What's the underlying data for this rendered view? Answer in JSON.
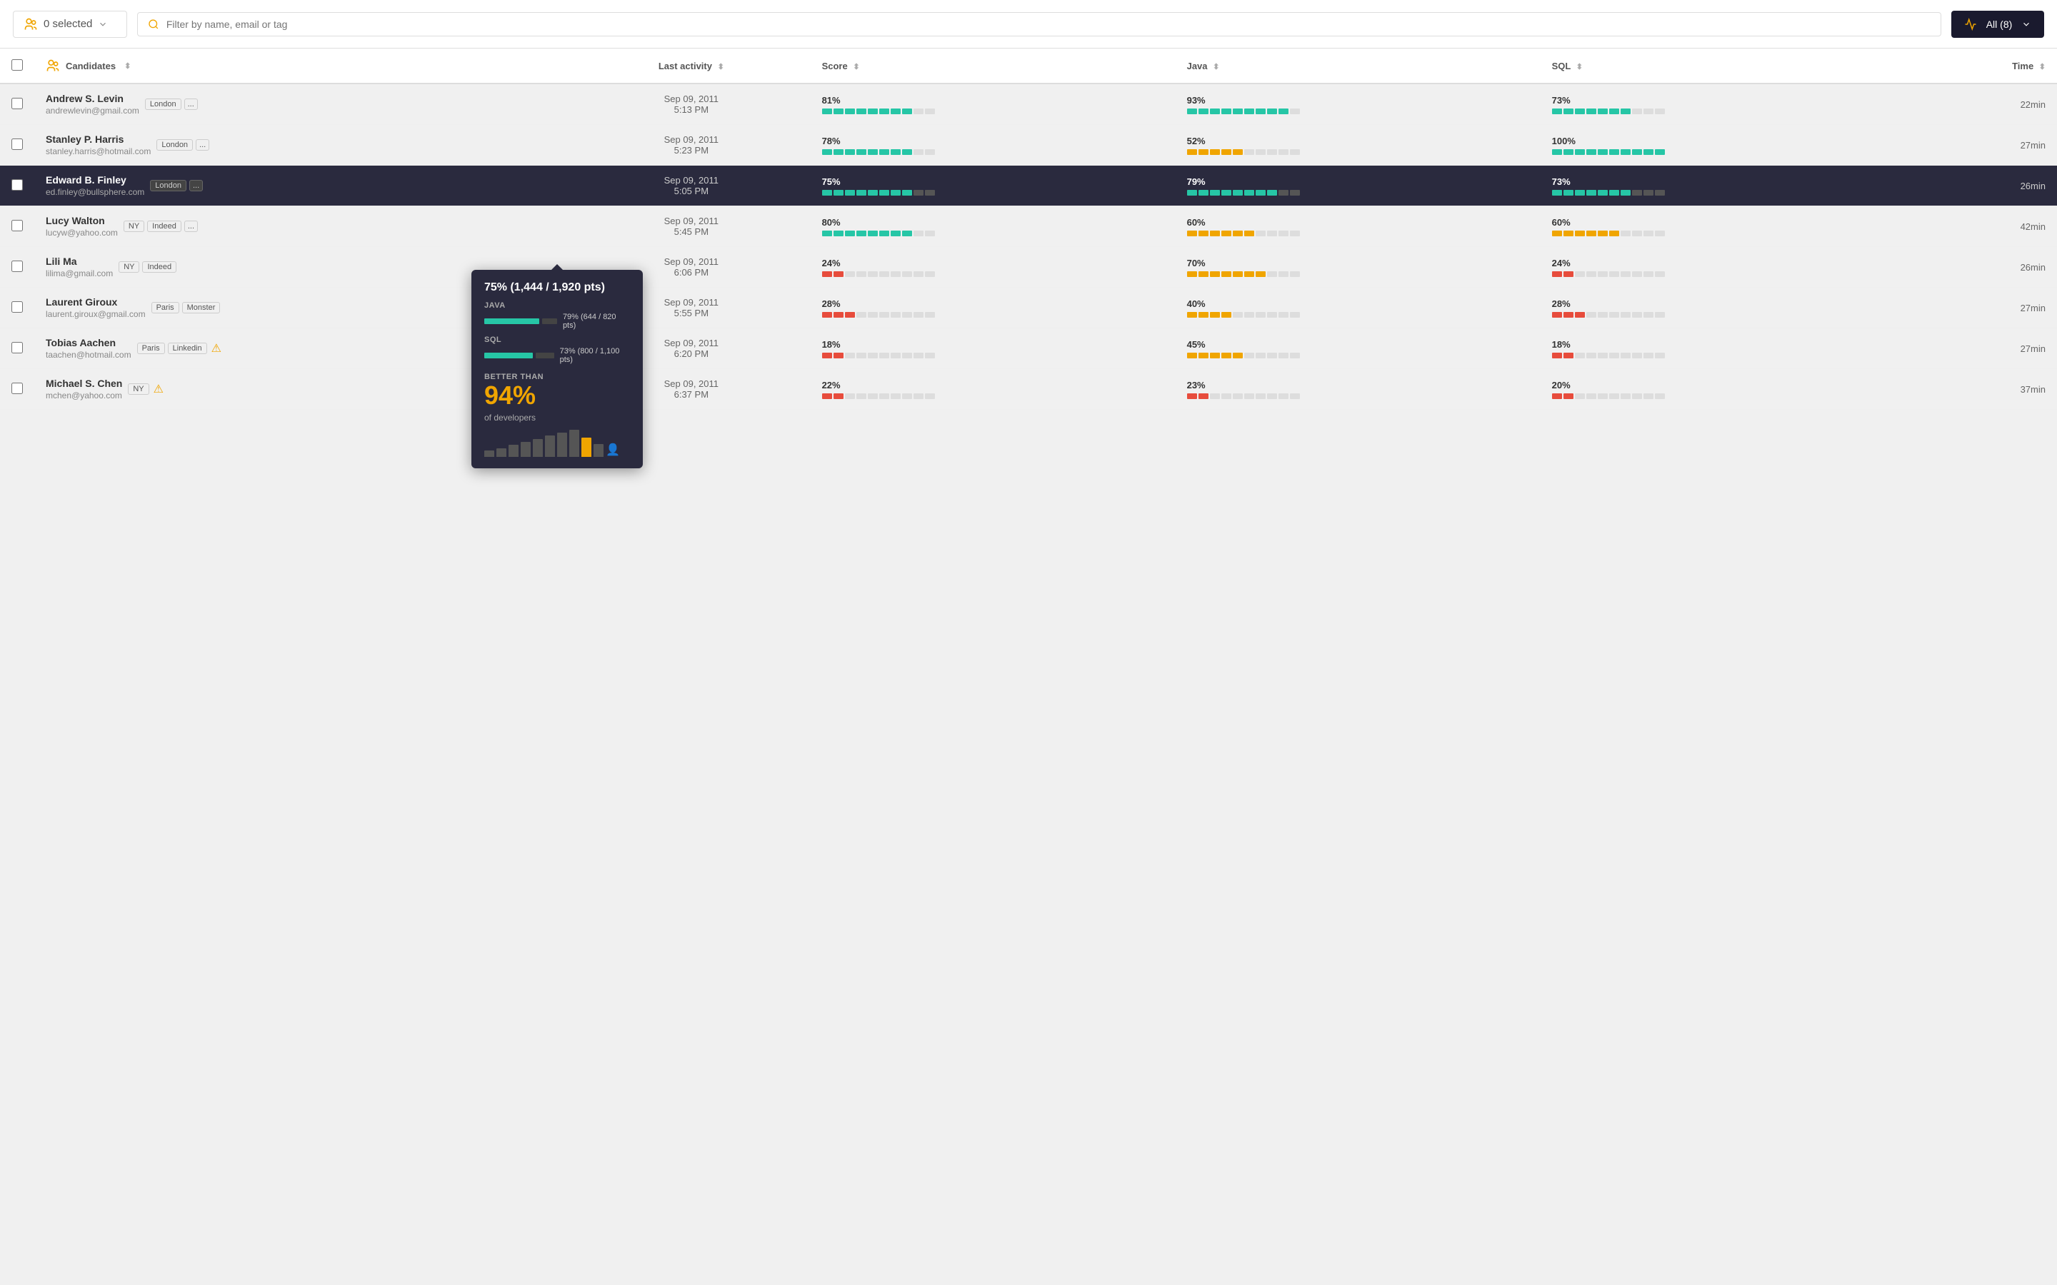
{
  "topbar": {
    "selected_label": "0 selected",
    "search_placeholder": "Filter by name, email or tag",
    "filter_label": "All (8)"
  },
  "table": {
    "columns": [
      "Candidates",
      "Last activity",
      "Score",
      "Java",
      "SQL",
      "Time"
    ],
    "rows": [
      {
        "id": 1,
        "name": "Andrew S. Levin",
        "email": "andrewlevin@gmail.com",
        "tags": [
          "London"
        ],
        "extra_tags": "...",
        "date": "Sep 09, 2011",
        "time_str": "5:13 PM",
        "score_pct": 81,
        "score_label": "81%",
        "score_color": "teal",
        "java_pct": 93,
        "java_label": "93%",
        "java_color": "teal",
        "sql_pct": 73,
        "sql_label": "73%",
        "sql_color": "teal",
        "duration": "22min",
        "highlighted": false,
        "warn": false
      },
      {
        "id": 2,
        "name": "Stanley P. Harris",
        "email": "stanley.harris@hotmail.com",
        "tags": [
          "London"
        ],
        "extra_tags": "...",
        "date": "Sep 09, 2011",
        "time_str": "5:23 PM",
        "score_pct": 78,
        "score_label": "78%",
        "score_color": "teal",
        "java_pct": 52,
        "java_label": "52%",
        "java_color": "yellow",
        "sql_pct": 100,
        "sql_label": "100%",
        "sql_color": "teal",
        "duration": "27min",
        "highlighted": false,
        "warn": false
      },
      {
        "id": 3,
        "name": "Edward B. Finley",
        "email": "ed.finley@bullsphere.com",
        "tags": [
          "London"
        ],
        "extra_tags": "...",
        "date": "Sep 09, 2011",
        "time_str": "5:05 PM",
        "score_pct": 75,
        "score_label": "75%",
        "score_color": "teal",
        "java_pct": 79,
        "java_label": "79%",
        "java_color": "teal",
        "sql_pct": 73,
        "sql_label": "73%",
        "sql_color": "teal",
        "duration": "26min",
        "highlighted": true,
        "warn": false,
        "tooltip": {
          "title": "75% (1,444 / 1,920 pts)",
          "java_label": "JAVA",
          "java_pct": "79% (644 / 820 pts)",
          "java_bar": 79,
          "sql_label": "SQL",
          "sql_pct": "73% (800 / 1,100 pts)",
          "sql_bar": 73,
          "better_than_label": "BETTER THAN",
          "better_than_pct": "94%",
          "of_devs": "of developers",
          "histogram_bars": [
            15,
            20,
            28,
            35,
            42,
            50,
            58,
            65,
            45,
            30
          ]
        }
      },
      {
        "id": 4,
        "name": "Lucy Walton",
        "email": "lucyw@yahoo.com",
        "tags": [
          "NY",
          "Indeed"
        ],
        "extra_tags": "...",
        "date": "Sep 09, 2011",
        "time_str": "5:45 PM",
        "score_pct": 80,
        "score_label": "80%",
        "score_color": "teal",
        "java_pct": 60,
        "java_label": "60%",
        "java_color": "yellow",
        "sql_pct": 60,
        "sql_label": "60%",
        "sql_color": "yellow",
        "duration": "42min",
        "highlighted": false,
        "warn": false
      },
      {
        "id": 5,
        "name": "Lili Ma",
        "email": "lilima@gmail.com",
        "tags": [
          "NY",
          "Indeed"
        ],
        "extra_tags": null,
        "date": "Sep 09, 2011",
        "time_str": "6:06 PM",
        "score_pct": 24,
        "score_label": "24%",
        "score_color": "red",
        "java_pct": 70,
        "java_label": "70%",
        "java_color": "yellow",
        "sql_pct": 24,
        "sql_label": "24%",
        "sql_color": "red",
        "duration": "26min",
        "highlighted": false,
        "warn": false
      },
      {
        "id": 6,
        "name": "Laurent Giroux",
        "email": "laurent.giroux@gmail.com",
        "tags": [
          "Paris",
          "Monster"
        ],
        "extra_tags": null,
        "date": "Sep 09, 2011",
        "time_str": "5:55 PM",
        "score_pct": 28,
        "score_label": "28%",
        "score_color": "red",
        "java_pct": 40,
        "java_label": "40%",
        "java_color": "yellow",
        "sql_pct": 28,
        "sql_label": "28%",
        "sql_color": "red",
        "duration": "27min",
        "highlighted": false,
        "warn": false
      },
      {
        "id": 7,
        "name": "Tobias Aachen",
        "email": "taachen@hotmail.com",
        "tags": [
          "Paris",
          "Linkedin"
        ],
        "extra_tags": null,
        "date": "Sep 09, 2011",
        "time_str": "6:20 PM",
        "score_pct": 18,
        "score_label": "18%",
        "score_color": "red",
        "java_pct": 45,
        "java_label": "45%",
        "java_color": "yellow",
        "sql_pct": 18,
        "sql_label": "18%",
        "sql_color": "red",
        "duration": "27min",
        "highlighted": false,
        "warn": true
      },
      {
        "id": 8,
        "name": "Michael S. Chen",
        "email": "mchen@yahoo.com",
        "tags": [
          "NY"
        ],
        "extra_tags": null,
        "date": "Sep 09, 2011",
        "time_str": "6:37 PM",
        "score_pct": 22,
        "score_label": "22%",
        "score_color": "red",
        "java_pct": 23,
        "java_label": "23%",
        "java_color": "red",
        "sql_pct": 20,
        "sql_label": "20%",
        "sql_color": "red",
        "duration": "37min",
        "highlighted": false,
        "warn": true
      }
    ]
  }
}
